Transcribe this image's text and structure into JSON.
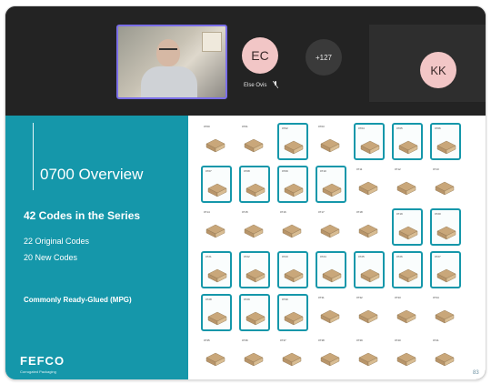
{
  "meeting": {
    "participant_ec": {
      "initials": "EC",
      "name": "Else Ovis"
    },
    "overflow_count": "+127",
    "participant_kk": {
      "initials": "KK"
    }
  },
  "slide": {
    "title": "0700 Overview",
    "subtitle": "42 Codes in the Series",
    "original_codes": "22 Original Codes",
    "new_codes": "20 New Codes",
    "mpg_note": "Commonly Ready-Glued (MPG)",
    "logo": "FEFCO",
    "logo_tagline": "Corrugated Packaging",
    "page_number": "83",
    "accent_color": "#1597aa",
    "box_color": "#c9a77a",
    "highlight_color": "#1597aa",
    "codes": [
      {
        "code": "0700",
        "highlighted": false
      },
      {
        "code": "0701",
        "highlighted": false
      },
      {
        "code": "0702",
        "highlighted": true
      },
      {
        "code": "0703",
        "highlighted": false
      },
      {
        "code": "0704",
        "highlighted": true
      },
      {
        "code": "0705",
        "highlighted": true
      },
      {
        "code": "0706",
        "highlighted": true
      },
      {
        "code": "0707",
        "highlighted": true
      },
      {
        "code": "0708",
        "highlighted": true
      },
      {
        "code": "0709",
        "highlighted": true
      },
      {
        "code": "0710",
        "highlighted": true
      },
      {
        "code": "0711",
        "highlighted": false
      },
      {
        "code": "0712",
        "highlighted": false
      },
      {
        "code": "0713",
        "highlighted": false
      },
      {
        "code": "0714",
        "highlighted": false
      },
      {
        "code": "0715",
        "highlighted": false
      },
      {
        "code": "0716",
        "highlighted": false
      },
      {
        "code": "0717",
        "highlighted": false
      },
      {
        "code": "0718",
        "highlighted": false
      },
      {
        "code": "0719",
        "highlighted": true
      },
      {
        "code": "0720",
        "highlighted": true
      },
      {
        "code": "0721",
        "highlighted": true
      },
      {
        "code": "0722",
        "highlighted": true
      },
      {
        "code": "0723",
        "highlighted": true
      },
      {
        "code": "0724",
        "highlighted": true
      },
      {
        "code": "0725",
        "highlighted": true
      },
      {
        "code": "0726",
        "highlighted": true
      },
      {
        "code": "0727",
        "highlighted": true
      },
      {
        "code": "0728",
        "highlighted": true
      },
      {
        "code": "0729",
        "highlighted": true
      },
      {
        "code": "0730",
        "highlighted": true
      },
      {
        "code": "0731",
        "highlighted": false
      },
      {
        "code": "0732",
        "highlighted": false
      },
      {
        "code": "0733",
        "highlighted": false
      },
      {
        "code": "0734",
        "highlighted": false
      },
      {
        "code": "0735",
        "highlighted": false
      },
      {
        "code": "0736",
        "highlighted": false
      },
      {
        "code": "0737",
        "highlighted": false
      },
      {
        "code": "0738",
        "highlighted": false
      },
      {
        "code": "0739",
        "highlighted": false
      },
      {
        "code": "0740",
        "highlighted": false
      },
      {
        "code": "0741",
        "highlighted": false
      }
    ]
  }
}
